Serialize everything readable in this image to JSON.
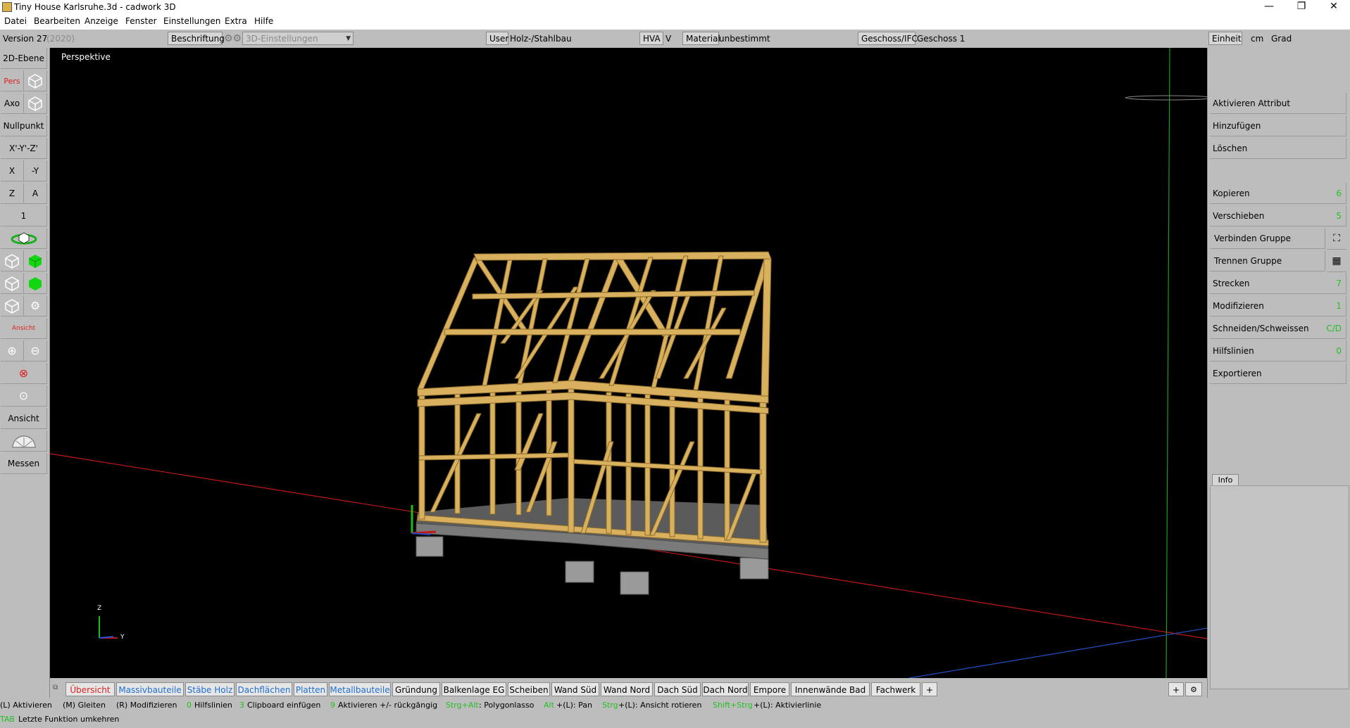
{
  "window": {
    "title": "Tiny House Karlsruhe.3d - cadwork 3D",
    "minimize": "—",
    "maximize": "❐",
    "close": "✕"
  },
  "menu": [
    "Datei",
    "Bearbeiten",
    "Anzeige",
    "Fenster",
    "Einstellungen",
    "Extra",
    "Hilfe"
  ],
  "infobar": {
    "version": "Version 27",
    "version_year": "(2020)",
    "beschriftung": "Beschriftung",
    "settings_dropdown": "3D-Einstellungen",
    "user_label": "User",
    "user_value": "Holz-/Stahlbau",
    "hva_label": "HVA",
    "hva_value": "V",
    "material_label": "Material",
    "material_value": "unbestimmt",
    "geschoss_label": "Geschoss/IFC",
    "geschoss_value": "Geschoss 1",
    "einheit_label": "Einheit",
    "einheit_value": "cm",
    "angle_unit": "Grad"
  },
  "left_toolbar": {
    "ebene": "2D-Ebene",
    "pers": "Pers",
    "axo": "Axo",
    "nullpunkt": "Nullpunkt",
    "xyz": "X'-Y'-Z'",
    "x": "X",
    "neg_y": "-Y",
    "z": "Z",
    "a": "A",
    "one": "1",
    "ansicht": "Ansicht",
    "messen": "Messen",
    "red_label": "Ansicht"
  },
  "viewport": {
    "label": "Perspektive",
    "triad_z": "Z",
    "triad_y": "Y"
  },
  "tabs": [
    {
      "label": "Übersicht",
      "color": "red"
    },
    {
      "label": "Massivbauteile",
      "color": "blue"
    },
    {
      "label": "Stäbe Holz",
      "color": "blue"
    },
    {
      "label": "Dachflächen",
      "color": "blue"
    },
    {
      "label": "Platten",
      "color": "blue"
    },
    {
      "label": "Metallbauteile",
      "color": "blue"
    },
    {
      "label": "Gründung",
      "color": "black"
    },
    {
      "label": "Balkenlage EG",
      "color": "black"
    },
    {
      "label": "Scheiben",
      "color": "black"
    },
    {
      "label": "Wand Süd",
      "color": "black"
    },
    {
      "label": "Wand Nord",
      "color": "black"
    },
    {
      "label": "Dach Süd",
      "color": "black"
    },
    {
      "label": "Dach Nord",
      "color": "black"
    },
    {
      "label": "Empore",
      "color": "black"
    },
    {
      "label": "Innenwände Bad",
      "color": "black"
    },
    {
      "label": "Fachwerk",
      "color": "black"
    },
    {
      "label": "+",
      "color": "black"
    }
  ],
  "tabbar_right": {
    "plus": "+"
  },
  "right_panel": {
    "aktivieren_attribut": "Aktivieren Attribut",
    "hinzufuegen": "Hinzufügen",
    "loeschen": "Löschen",
    "kopieren": "Kopieren",
    "kopieren_key": "6",
    "verschieben": "Verschieben",
    "verschieben_key": "5",
    "verbinden": "Verbinden Gruppe",
    "trennen": "Trennen Gruppe",
    "strecken": "Strecken",
    "strecken_key": "7",
    "modifizieren": "Modifizieren",
    "modifizieren_key": "1",
    "schneiden": "Schneiden/Schweissen",
    "schneiden_key": "C/D",
    "hilfslinien": "Hilfslinien",
    "hilfslinien_key": "0",
    "exportieren": "Exportieren",
    "info": "Info"
  },
  "status": {
    "l_aktivieren": "(L) Aktivieren",
    "m_gleiten": "(M) Gleiten",
    "r_modifizieren": "(R) Modifizieren",
    "k0": "0",
    "hilfslinien": "Hilfslinien",
    "k3": "3",
    "clipboard": "Clipboard einfügen",
    "k9": "9",
    "aktivieren_rueck": "Aktivieren +/- rückgängig",
    "strg_alt": "Strg+Alt",
    "polygonlasso": ": Polygonlasso",
    "alt": "Alt",
    "pan": "+(L): Pan",
    "strg": "Strg",
    "rotieren": "+(L): Ansicht rotieren",
    "shift_strg": "Shift+Strg",
    "aktivierlinie": "+(L): Aktivierlinie",
    "tab": "TAB",
    "letzte": "Letzte Funktion umkehren"
  },
  "colors": {
    "viewport_bg": "#000000",
    "timber": "#d9b15e",
    "axis_x": "#d02020",
    "axis_y": "#2050d0",
    "axis_z": "#20c020",
    "accent_green": "#22c022",
    "tab_blue": "#1e6fd0",
    "tab_red": "#e02020"
  }
}
